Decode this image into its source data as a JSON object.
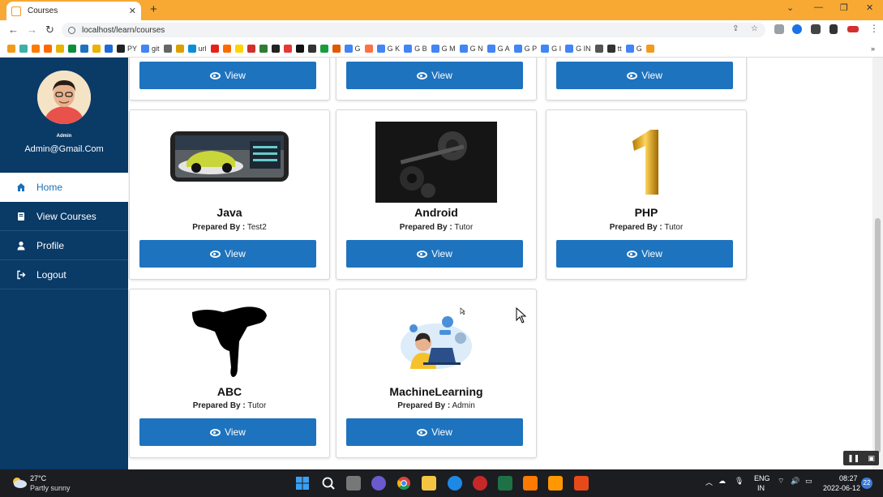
{
  "browser": {
    "tab_title": "Courses",
    "tab_close": "✕",
    "new_tab": "+",
    "url": "localhost/learn/courses",
    "bookmarks": [
      {
        "label": "",
        "color": "#f29a1e"
      },
      {
        "label": "",
        "color": "#3fb0a8"
      },
      {
        "label": "",
        "color": "#ff7a00"
      },
      {
        "label": "",
        "color": "#ff6a00"
      },
      {
        "label": "",
        "color": "#e7b400"
      },
      {
        "label": "",
        "color": "#0a8f3c"
      },
      {
        "label": "",
        "color": "#1e73be"
      },
      {
        "label": "",
        "color": "#e9b300"
      },
      {
        "label": "",
        "color": "#1c6ad9"
      },
      {
        "label": "PY",
        "color": "#222"
      },
      {
        "label": "git",
        "color": "#4285f4"
      },
      {
        "label": "",
        "color": "#666"
      },
      {
        "label": "",
        "color": "#d9a000"
      },
      {
        "label": "url",
        "color": "#0a8fd6"
      },
      {
        "label": "",
        "color": "#e62117"
      },
      {
        "label": "",
        "color": "#ff6a00"
      },
      {
        "label": "",
        "color": "#ffd400"
      },
      {
        "label": "",
        "color": "#d32f2f"
      },
      {
        "label": "",
        "color": "#2e7d32"
      },
      {
        "label": "",
        "color": "#222"
      },
      {
        "label": "",
        "color": "#e53935"
      },
      {
        "label": "",
        "color": "#111"
      },
      {
        "label": "",
        "color": "#333"
      },
      {
        "label": "",
        "color": "#1a9c3e"
      },
      {
        "label": "",
        "color": "#e05a00"
      },
      {
        "label": "G",
        "color": "#4285f4"
      },
      {
        "label": "",
        "color": "#ff7043"
      },
      {
        "label": "G K",
        "color": "#4285f4"
      },
      {
        "label": "G B",
        "color": "#4285f4"
      },
      {
        "label": "G M",
        "color": "#4285f4"
      },
      {
        "label": "G N",
        "color": "#4285f4"
      },
      {
        "label": "G A",
        "color": "#4285f4"
      },
      {
        "label": "G P",
        "color": "#4285f4"
      },
      {
        "label": "G I",
        "color": "#4285f4"
      },
      {
        "label": "G IN",
        "color": "#4285f4"
      },
      {
        "label": "",
        "color": "#555"
      },
      {
        "label": "tt",
        "color": "#333"
      },
      {
        "label": "G",
        "color": "#4285f4"
      },
      {
        "label": "",
        "color": "#f29a1e"
      }
    ],
    "more_bookmarks": "»"
  },
  "sidebar": {
    "role": "Admin",
    "email": "Admin@Gmail.Com",
    "menu": [
      {
        "label": "Home",
        "icon": "home-icon",
        "active": true
      },
      {
        "label": "View Courses",
        "icon": "book-icon",
        "active": false
      },
      {
        "label": "Profile",
        "icon": "user-icon",
        "active": false
      },
      {
        "label": "Logout",
        "icon": "logout-icon",
        "active": false
      }
    ]
  },
  "courses": {
    "prepared_prefix": "Prepared By :",
    "view_label": "View",
    "items": [
      {
        "title": "Java",
        "author": "Test2",
        "image": "racing-game-phone-image"
      },
      {
        "title": "Android",
        "author": "Tutor",
        "image": "dumbbell-image"
      },
      {
        "title": "PHP",
        "author": "Tutor",
        "image": "golden-number-one-image"
      },
      {
        "title": "ABC",
        "author": "Tutor",
        "image": "breakdancer-silhouette-image"
      },
      {
        "title": "MachineLearning",
        "author": "Admin",
        "image": "person-laptop-illustration"
      }
    ]
  },
  "taskbar": {
    "temperature": "27°C",
    "weather": "Partly sunny",
    "language_top": "ENG",
    "language_bottom": "IN",
    "time": "08:27",
    "date": "2022-06-12",
    "notifications": "22"
  },
  "colors": {
    "sidebar_bg": "#0a3a66",
    "button_bg": "#1e73be",
    "tab_bar": "#f7a934"
  }
}
